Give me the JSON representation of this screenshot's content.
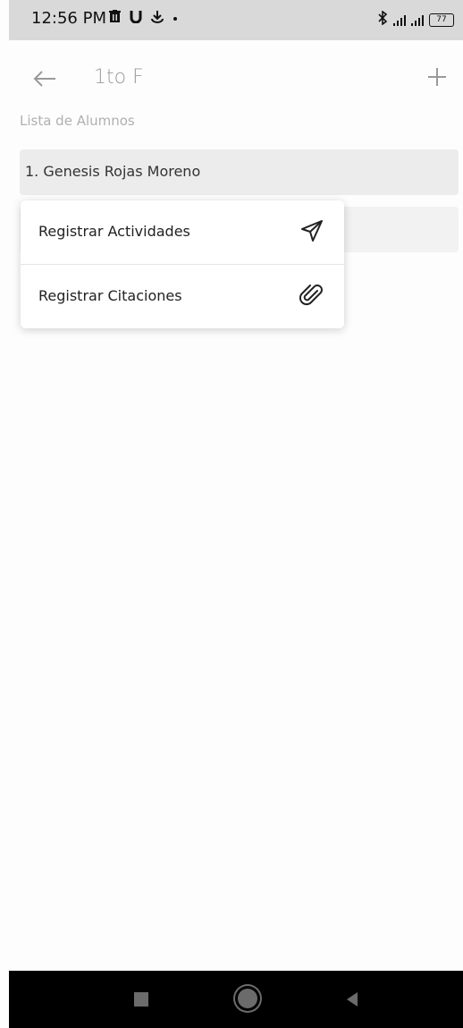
{
  "status_bar": {
    "time": "12:56 PM",
    "left_icons": [
      "trash-icon",
      "u-icon",
      "download-icon",
      "dot-icon"
    ],
    "battery": "77"
  },
  "app_bar": {
    "title": "1to F",
    "back_icon": "arrow-left-icon",
    "add_icon": "plus-icon"
  },
  "section_label": "Lista de Alumnos",
  "students": [
    {
      "label": "1. Genesis  Rojas Moreno"
    }
  ],
  "popup_menu": {
    "items": [
      {
        "label": "Registrar  Actividades",
        "icon": "paper-plane-icon"
      },
      {
        "label": "Registrar Citaciones",
        "icon": "paperclip-icon"
      }
    ]
  },
  "colors": {
    "status_bar": "#d9d9d9",
    "row_bg": "#ececec",
    "title": "#9c9c9c",
    "nav_bar": "#000000"
  }
}
